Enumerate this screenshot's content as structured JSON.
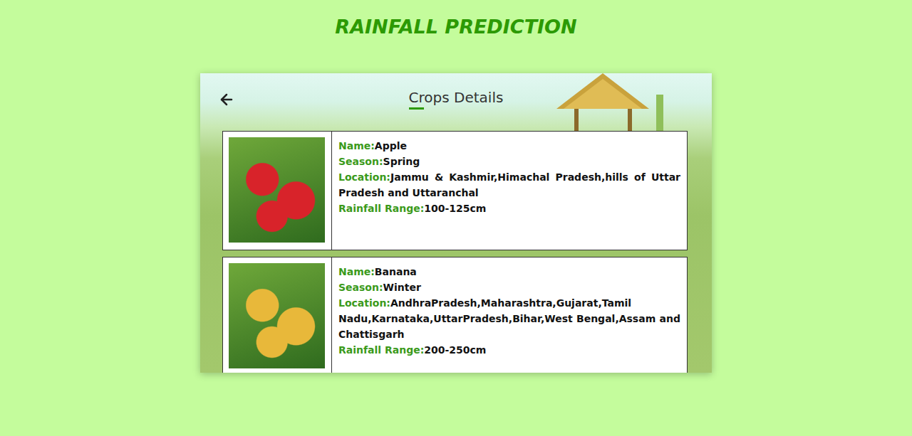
{
  "page": {
    "title": "RAINFALL PREDICTION"
  },
  "panel": {
    "heading": "Crops Details"
  },
  "labels": {
    "name": "Name:",
    "season": "Season:",
    "location": "Location:",
    "rainfall": "Rainfall Range:"
  },
  "crops": [
    {
      "name": "Apple",
      "season": "Spring",
      "location": "Jammu & Kashmir,Himachal Pradesh,hills of Uttar Pradesh and Uttaranchal",
      "rainfall": "100-125cm",
      "color": "#d8232a"
    },
    {
      "name": "Banana",
      "season": "Winter",
      "location": "AndhraPradesh,Maharashtra,Gujarat,Tamil Nadu,Karnataka,UttarPradesh,Bihar,West Bengal,Assam and Chattisgarh",
      "rainfall": "200-250cm",
      "color": "#e8b83a"
    }
  ]
}
